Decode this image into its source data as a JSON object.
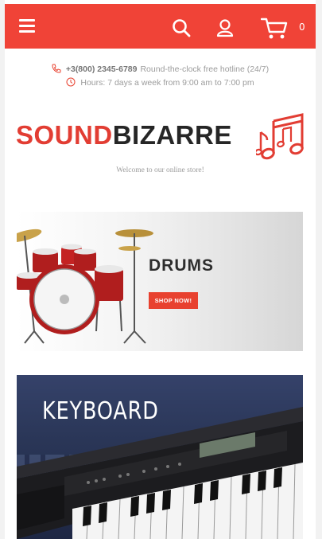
{
  "header": {
    "menu_icon": "hamburger-icon",
    "search_icon": "search-icon",
    "account_icon": "user-icon",
    "cart_icon": "cart-icon",
    "cart_count": "0",
    "accent_color": "#f04337"
  },
  "contacts": {
    "phone": "+3(800) 2345-6789",
    "phone_note": "Round-the-clock free hotline (24/7)",
    "hours": "Hours: 7 days a week from 9:00 am to 7:00 pm"
  },
  "brand": {
    "logo_part1": "SOUND",
    "logo_part2": "BIZARRE",
    "tagline": "Welcome to our online store!"
  },
  "banners": [
    {
      "title": "DRUMS",
      "button_label": "SHOP NOW!"
    },
    {
      "title": "KEYBOARD"
    }
  ]
}
